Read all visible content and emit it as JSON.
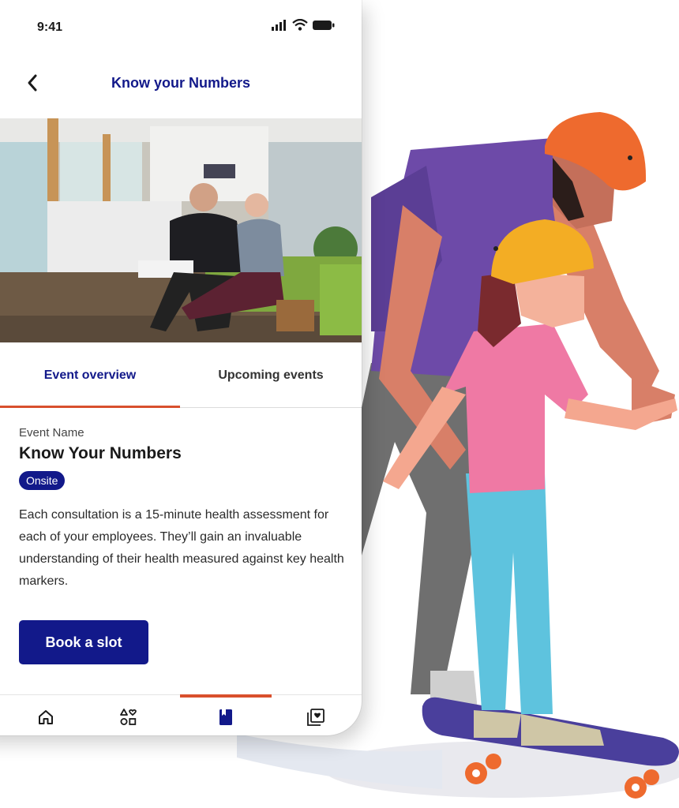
{
  "status_bar": {
    "time": "9:41"
  },
  "header": {
    "title": "Know your Numbers"
  },
  "tabs": [
    {
      "label": "Event overview",
      "active": true
    },
    {
      "label": "Upcoming events",
      "active": false
    }
  ],
  "event": {
    "label": "Event Name",
    "name": "Know Your Numbers",
    "badge": "Onsite",
    "description": "Each consultation is a 15-minute health assessment for each of your employees. They’ll gain an invaluable understanding of their health measured against key health markers."
  },
  "cta": {
    "label": "Book a slot"
  },
  "bottom_nav": [
    {
      "icon": "home-icon",
      "active": false
    },
    {
      "icon": "categories-icon",
      "active": false
    },
    {
      "icon": "bookmark-icon",
      "active": true
    },
    {
      "icon": "saved-icon",
      "active": false
    }
  ],
  "colors": {
    "brand_navy": "#12198a",
    "accent_orange": "#d9502d",
    "text_dark": "#1a1a1a"
  }
}
